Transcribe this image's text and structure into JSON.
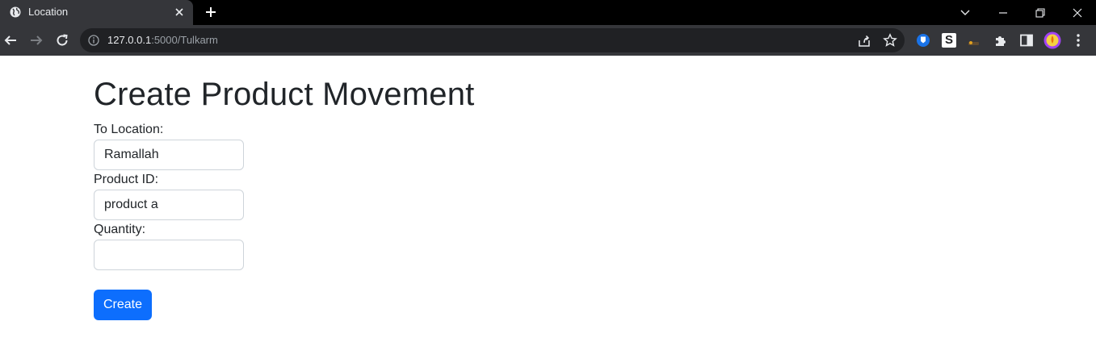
{
  "browser": {
    "tab_title": "Location",
    "url_host": "127.0.0.1",
    "url_rest": ":5000/Tulkarm",
    "ext_s_label": "S"
  },
  "form": {
    "title": "Create Product Movement",
    "to_location_label": "To Location:",
    "to_location_value": "Ramallah",
    "product_id_label": "Product ID:",
    "product_id_value": "product a",
    "quantity_label": "Quantity:",
    "quantity_value": "",
    "submit_label": "Create"
  },
  "colors": {
    "primary": "#0d6efd",
    "chrome_dark": "#35363a",
    "omnibox": "#202124",
    "text": "#212529"
  }
}
